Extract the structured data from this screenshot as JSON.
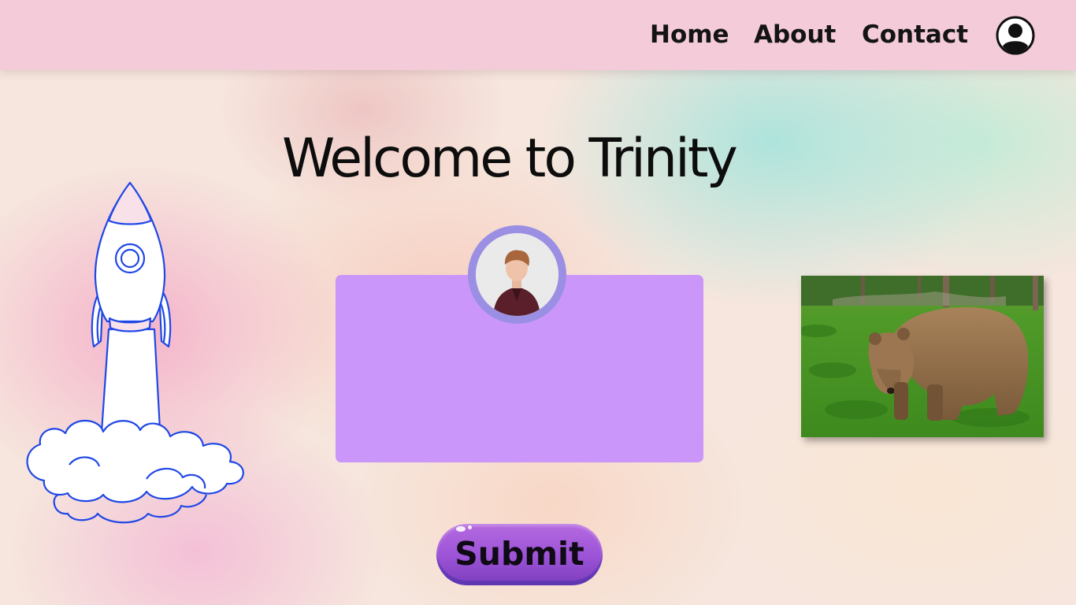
{
  "nav": {
    "links": [
      {
        "label": "Home"
      },
      {
        "label": "About"
      },
      {
        "label": "Contact"
      }
    ],
    "profile_icon": "user-profile-icon"
  },
  "hero": {
    "title": "Welcome to Trinity"
  },
  "card": {
    "avatar_icon": "user-photo"
  },
  "media": {
    "photo_subject": "brown-bear-photo",
    "illustration": "rocket-launch-illustration"
  },
  "form": {
    "submit_label": "Submit"
  },
  "colors": {
    "navbar": "#f4cbd8",
    "card": "#cb96fa",
    "avatar_ring": "#9a8fe3",
    "submit_button": "#9b52d6",
    "rocket_stroke": "#1f47e6"
  }
}
